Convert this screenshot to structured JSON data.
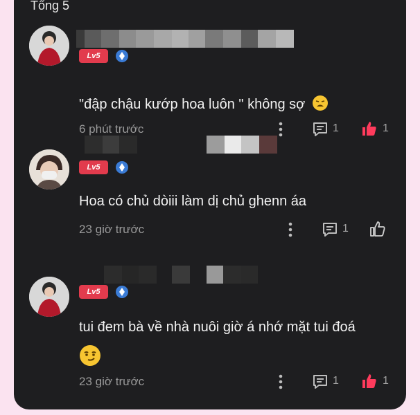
{
  "header": {
    "title": "Tổng 5"
  },
  "comments": [
    {
      "level": "Lv5",
      "text": "\"đập chậu kướp hoa luôn \" không sợ",
      "emoji": "tired-face-emoji",
      "time": "6 phút trước",
      "reply_count": "1",
      "like_count": "1",
      "liked": true
    },
    {
      "level": "Lv5",
      "text": "Hoa có chủ dòiii làm dị chủ ghenn áa",
      "time": "23 giờ trước",
      "reply_count": "1",
      "like_count": "",
      "liked": false
    },
    {
      "level": "Lv5",
      "text": "tui đem bà về nhà nuôi giờ á nhớ mặt tui đoá",
      "emoji": "smirk-face-emoji",
      "time": "23 giờ trước",
      "reply_count": "1",
      "like_count": "1",
      "liked": true
    }
  ],
  "colors": {
    "panel_bg": "#1e1e20",
    "page_bg": "#fbe3f0",
    "like_active": "#ff3b5c",
    "level_badge": "#e23b4d",
    "verify_blue": "#3a7bd5"
  }
}
